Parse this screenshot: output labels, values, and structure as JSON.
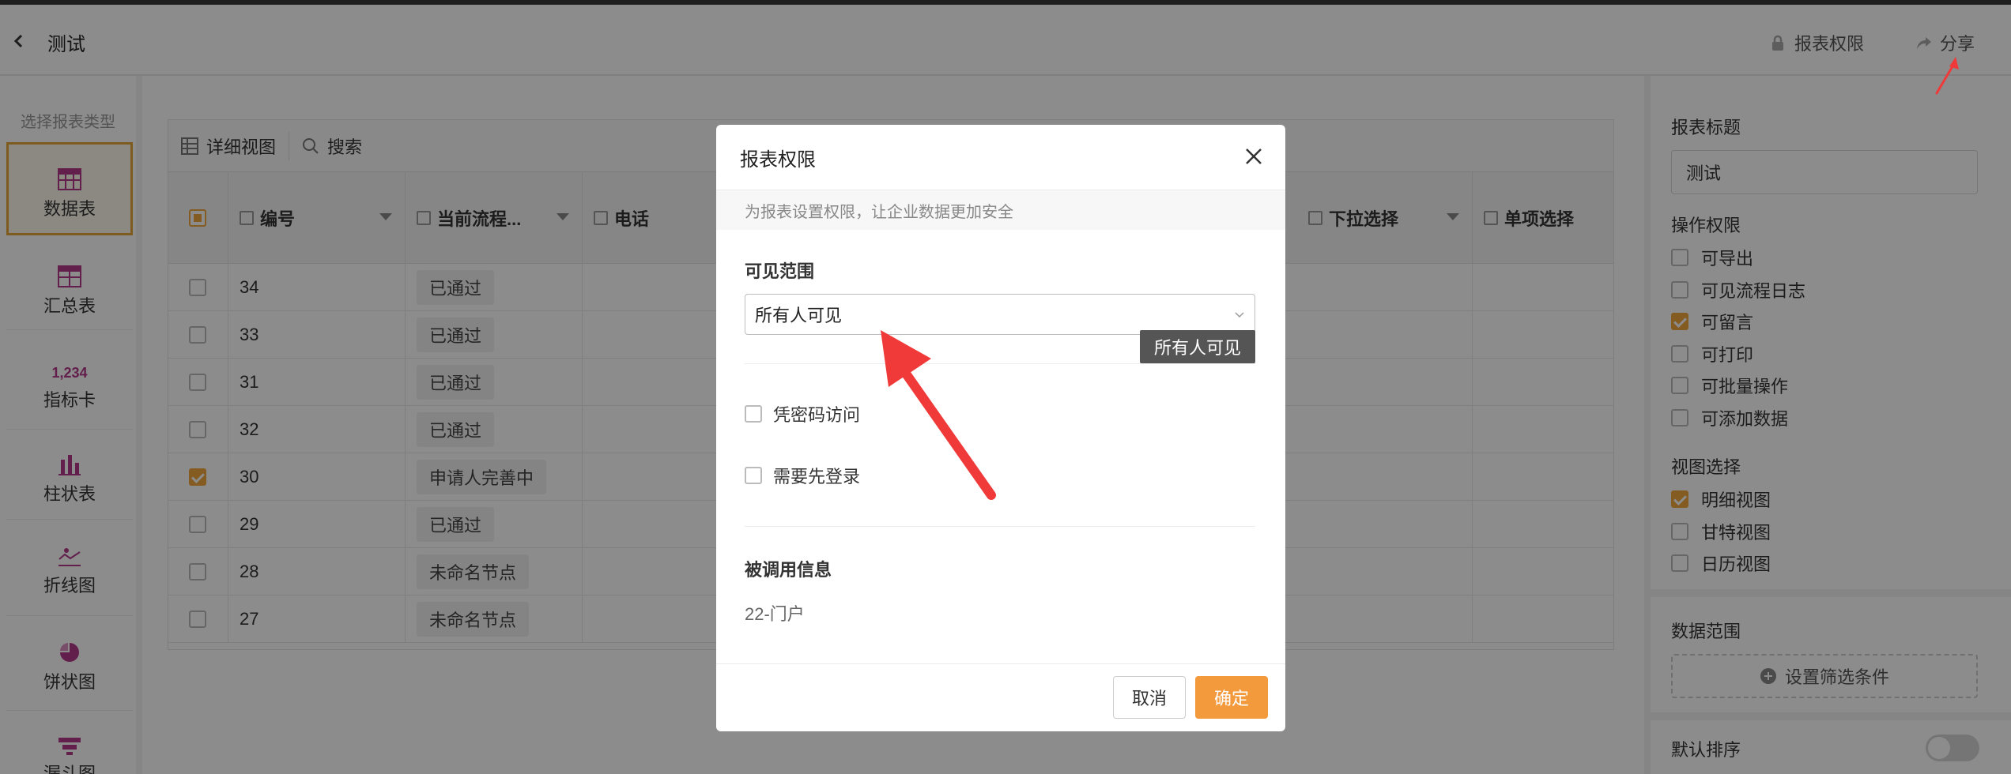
{
  "header": {
    "title": "测试",
    "permission_label": "报表权限",
    "share_label": "分享"
  },
  "left_panel": {
    "title": "选择报表类型",
    "items": [
      {
        "label": "数据表",
        "icon": "table-icon",
        "active": true
      },
      {
        "label": "汇总表",
        "icon": "summary-table-icon",
        "active": false
      },
      {
        "label": "指标卡",
        "icon": "metric-card-icon",
        "active": false,
        "icon_text": "1,234"
      },
      {
        "label": "柱状表",
        "icon": "bar-chart-icon",
        "active": false
      },
      {
        "label": "折线图",
        "icon": "line-chart-icon",
        "active": false
      },
      {
        "label": "饼状图",
        "icon": "pie-chart-icon",
        "active": false
      },
      {
        "label": "漏斗图",
        "icon": "funnel-chart-icon",
        "active": false
      }
    ]
  },
  "toolbar": {
    "detail_view_label": "详细视图",
    "search_label": "搜索"
  },
  "table": {
    "columns": [
      "编号",
      "当前流程...",
      "电话",
      "下拉选择",
      "单项选择"
    ],
    "rows": [
      {
        "checked": false,
        "id": "34",
        "status": "已通过"
      },
      {
        "checked": false,
        "id": "33",
        "status": "已通过"
      },
      {
        "checked": false,
        "id": "31",
        "status": "已通过"
      },
      {
        "checked": false,
        "id": "32",
        "status": "已通过"
      },
      {
        "checked": true,
        "id": "30",
        "status": "申请人完善中"
      },
      {
        "checked": false,
        "id": "29",
        "status": "已通过"
      },
      {
        "checked": false,
        "id": "28",
        "status": "未命名节点"
      },
      {
        "checked": false,
        "id": "27",
        "status": "未命名节点"
      }
    ]
  },
  "right_panel": {
    "report_title_label": "报表标题",
    "report_title_value": "测试",
    "op_perm_label": "操作权限",
    "op_perms": [
      {
        "label": "可导出",
        "checked": false
      },
      {
        "label": "可见流程日志",
        "checked": false
      },
      {
        "label": "可留言",
        "checked": true
      },
      {
        "label": "可打印",
        "checked": false
      },
      {
        "label": "可批量操作",
        "checked": false
      },
      {
        "label": "可添加数据",
        "checked": false
      }
    ],
    "view_select_label": "视图选择",
    "views": [
      {
        "label": "明细视图",
        "checked": true
      },
      {
        "label": "甘特视图",
        "checked": false
      },
      {
        "label": "日历视图",
        "checked": false
      }
    ],
    "data_range_label": "数据范围",
    "filter_button": "设置筛选条件",
    "default_sort_label": "默认排序",
    "default_sort_on": false
  },
  "modal": {
    "title": "报表权限",
    "subtitle": "为报表设置权限，让企业数据更加安全",
    "visible_range_label": "可见范围",
    "visible_range_value": "所有人可见",
    "tooltip": "所有人可见",
    "password_access_label": "凭密码访问",
    "password_access_checked": false,
    "require_login_label": "需要先登录",
    "require_login_checked": false,
    "called_info_label": "被调用信息",
    "called_info_value": "22-门户",
    "cancel_label": "取消",
    "ok_label": "确定"
  },
  "colors": {
    "accent": "#f39a3c",
    "checkbox_checked": "#f0a63c",
    "arrow_annotation": "#f03a3a",
    "overlay": "rgba(0,0,0,0.45)"
  }
}
